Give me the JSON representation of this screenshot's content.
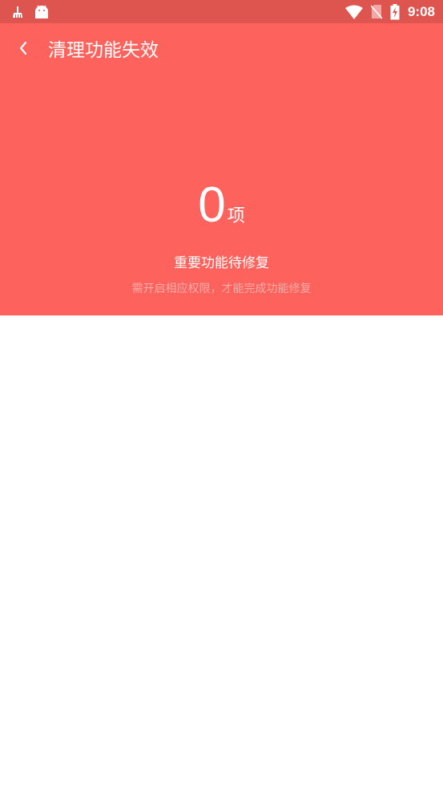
{
  "status_bar": {
    "time": "9:08",
    "left_icons": [
      "cleaner-icon",
      "android-icon"
    ],
    "right_icons": [
      "wifi-icon",
      "no-sim-icon",
      "battery-charging-icon"
    ]
  },
  "header": {
    "title": "清理功能失效",
    "back_icon": "chevron-left-icon"
  },
  "summary": {
    "count": "0",
    "unit": "项",
    "headline": "重要功能待修复",
    "subtext": "需开启相应权限，才能完成功能修复"
  },
  "colors": {
    "status_bar": "#de554f",
    "hero": "#fd625d",
    "subtext": "#f7aca8",
    "background": "#ffffff"
  }
}
